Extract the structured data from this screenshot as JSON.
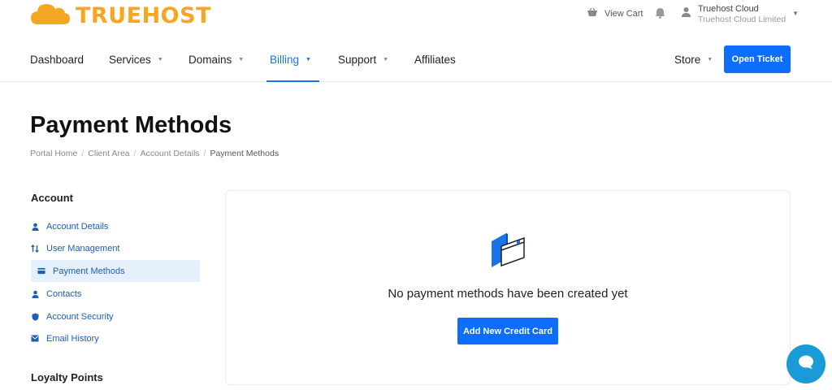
{
  "brand": {
    "name": "TRUEHOST",
    "color": "#f5a623",
    "logo_icon": "cloud-icon"
  },
  "header": {
    "cart_label": "View Cart",
    "user_name": "Truehost Cloud",
    "user_company": "Truehost Cloud Limited"
  },
  "nav": {
    "items": [
      {
        "label": "Dashboard",
        "has_dropdown": false
      },
      {
        "label": "Services",
        "has_dropdown": true
      },
      {
        "label": "Domains",
        "has_dropdown": true
      },
      {
        "label": "Billing",
        "has_dropdown": true,
        "active": true
      },
      {
        "label": "Support",
        "has_dropdown": true
      },
      {
        "label": "Affiliates",
        "has_dropdown": false
      }
    ],
    "store_label": "Store",
    "open_ticket_label": "Open Ticket"
  },
  "page": {
    "title": "Payment Methods",
    "breadcrumb": [
      "Portal Home",
      "Client Area",
      "Account Details",
      "Payment Methods"
    ]
  },
  "sidebar": {
    "account_heading": "Account",
    "items": [
      {
        "label": "Account Details",
        "icon": "user-icon"
      },
      {
        "label": "User Management",
        "icon": "arrows-icon"
      },
      {
        "label": "Payment Methods",
        "icon": "credit-card-icon",
        "active": true
      },
      {
        "label": "Contacts",
        "icon": "user-icon"
      },
      {
        "label": "Account Security",
        "icon": "shield-icon"
      },
      {
        "label": "Email History",
        "icon": "envelope-icon"
      }
    ],
    "loyalty_heading": "Loyalty Points"
  },
  "main": {
    "empty_message": "No payment methods have been created yet",
    "add_card_label": "Add New Credit Card"
  },
  "colors": {
    "primary": "#0d6efd",
    "link": "#1a5fb4",
    "chat": "#1a9ad6"
  }
}
